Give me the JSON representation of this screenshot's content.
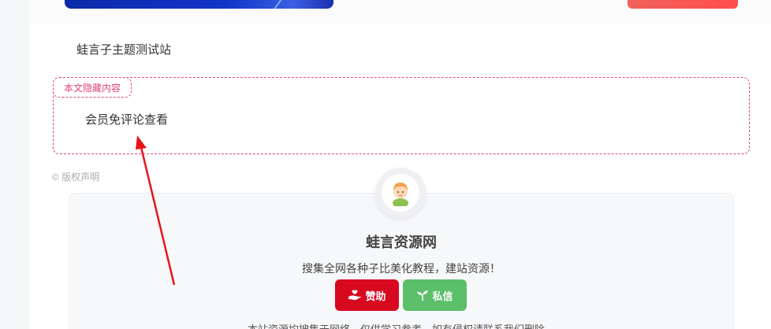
{
  "post": {
    "site_line": "蛙言子主题测试站",
    "hidden_tag": "本文隐藏内容",
    "hidden_text": "会员免评论查看",
    "copyright": "© 版权声明"
  },
  "author": {
    "name": "蛙言资源网",
    "description": "搜集全网各种子比美化教程，建站资源！",
    "donate_label": "赞助",
    "message_label": "私信",
    "disclaimer": "本站资源均搜集于网络，仅供学习参考，如有侵权请联系我们删除。"
  },
  "colors": {
    "accent_pink": "#e0467a",
    "donate_red": "#d6091f",
    "message_green": "#5cbf6a",
    "arrow_red": "#e8141c"
  },
  "icons": {
    "donate": "hand-heart-icon",
    "message": "sprout-icon",
    "avatar": "child-avatar-icon"
  }
}
